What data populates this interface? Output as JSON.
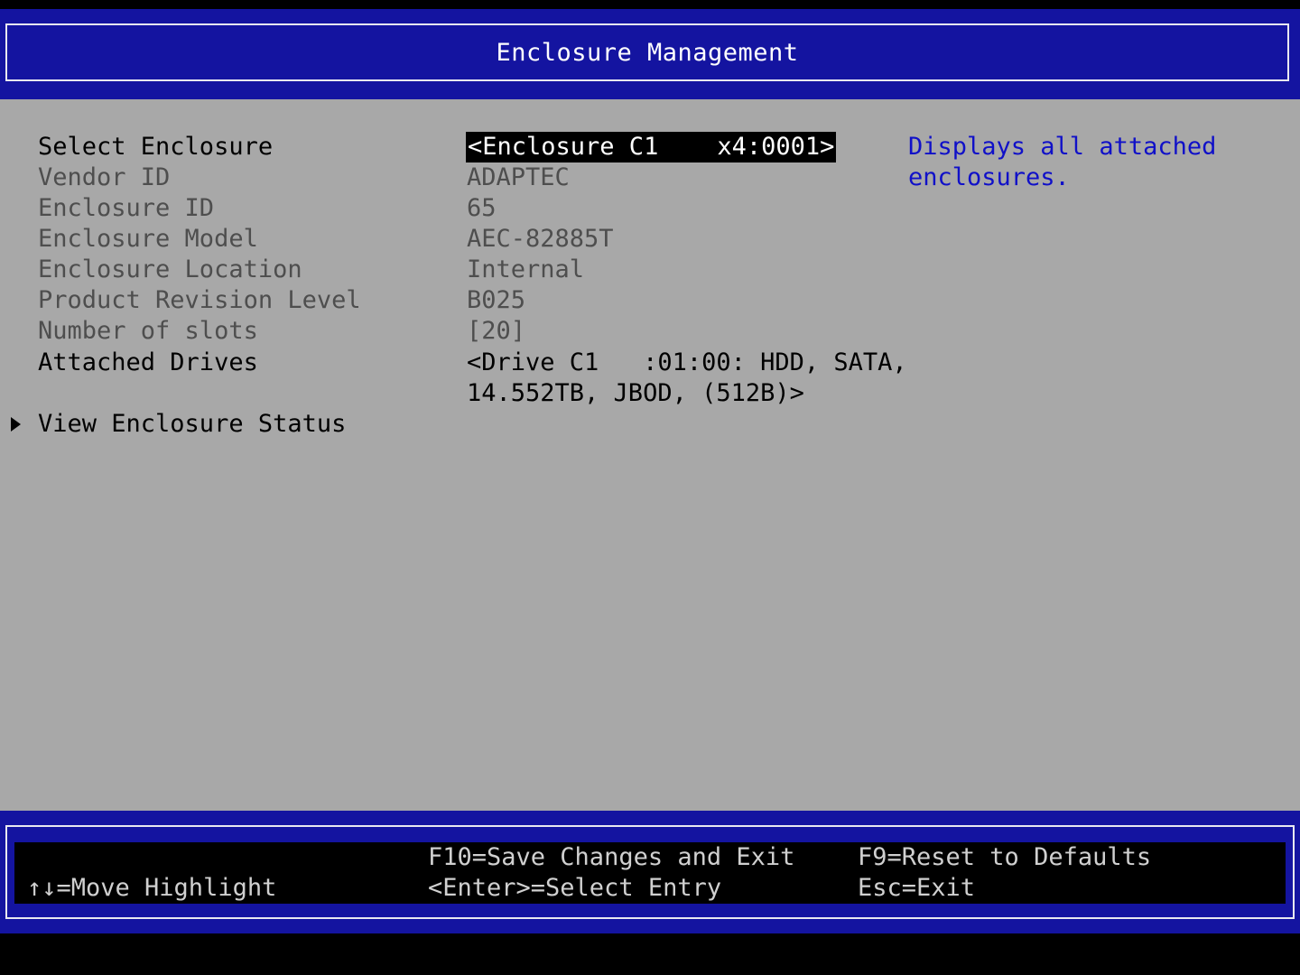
{
  "header": {
    "title": "Enclosure Management"
  },
  "form": {
    "rows": [
      {
        "label": "Select Enclosure",
        "value": "<Enclosure C1    x4:0001>"
      },
      {
        "label": "Vendor ID",
        "value": "ADAPTEC"
      },
      {
        "label": "Enclosure ID",
        "value": "65"
      },
      {
        "label": "Enclosure Model",
        "value": "AEC-82885T"
      },
      {
        "label": "Enclosure Location",
        "value": "Internal"
      },
      {
        "label": "Product Revision Level",
        "value": "B025"
      },
      {
        "label": "Number of slots",
        "value": "[20]"
      },
      {
        "label": "Attached Drives",
        "value_line1": "<Drive C1   :01:00: HDD, SATA,",
        "value_line2": "14.552TB, JBOD, (512B)>"
      }
    ],
    "submenu": {
      "label": "View Enclosure Status"
    }
  },
  "help": {
    "text": "Displays all attached\nenclosures."
  },
  "footer": {
    "move_highlight": "↑↓=Move Highlight",
    "save_exit": "F10=Save Changes and Exit",
    "select_entry": "<Enter>=Select Entry",
    "reset_defaults": "F9=Reset to Defaults",
    "esc_exit": "Esc=Exit"
  },
  "colors": {
    "header_bg": "#1414a0",
    "body_bg": "#a8a8a8",
    "help_text": "#1010c8",
    "disabled_text": "#4e4e4e"
  }
}
